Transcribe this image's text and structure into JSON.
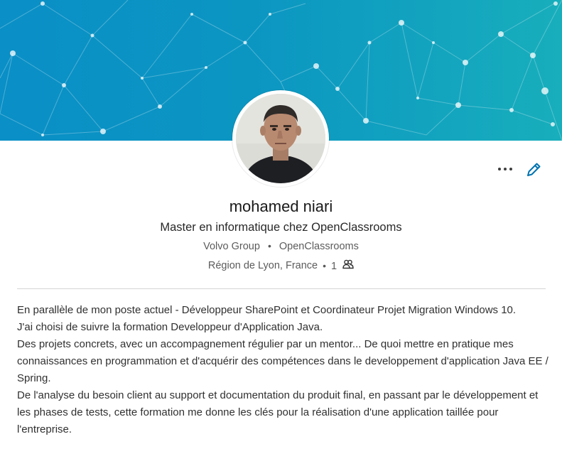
{
  "profile": {
    "name": "mohamed niari",
    "headline": "Master en informatique chez OpenClassrooms",
    "company_current": "Volvo Group",
    "company_school": "OpenClassrooms",
    "location": "Région de Lyon, France",
    "connections": "1",
    "separator": "•"
  },
  "summary": {
    "lines": [
      "En parallèle de mon poste actuel - Développeur SharePoint et Coordinateur Projet Migration Windows 10.",
      "J'ai choisi de suivre la formation Developpeur d'Application Java.",
      "Des projets concrets, avec un accompagnement régulier par un mentor... De quoi mettre en pratique mes connaissances en programmation et d'acquérir des compétences dans le developpement d'application Java EE / Spring.",
      "De l'analyse du besoin client au support et documentation du produit final, en passant par le développement et les phases de tests, cette formation me donne les clés pour la réalisation d'une application taillée pour l'entreprise."
    ]
  },
  "actions": {
    "more_icon": "more-horizontal-icon",
    "edit_icon": "pencil-icon"
  },
  "colors": {
    "banner_start": "#0a8fc6",
    "banner_end": "#18aebc",
    "edit_icon": "#0073b1",
    "divider": "#d4d4d4"
  }
}
